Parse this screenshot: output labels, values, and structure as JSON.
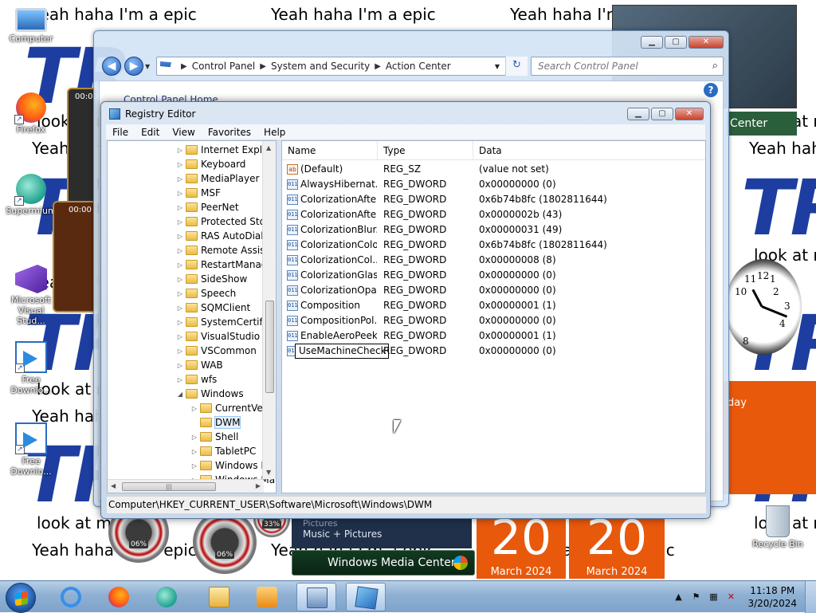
{
  "wallpaper": {
    "repeat_text_1": "Yeah haha I'm a epic",
    "repeat_text_2": "look at m",
    "logo_text": "TR"
  },
  "desktop_icons": [
    {
      "label": "Computer",
      "icon": "computer-icon"
    },
    {
      "label": "Firefox",
      "icon": "firefox-icon"
    },
    {
      "label": "Supermium",
      "icon": "supermium-icon"
    },
    {
      "label": "Microsoft Visual Stud...",
      "icon": "visual-studio-icon"
    },
    {
      "label": "Free Downlo...",
      "icon": "download-icon"
    },
    {
      "label": "Free Downlo...",
      "icon": "download-icon"
    },
    {
      "label": "Recycle Bin",
      "icon": "recycle-bin-icon"
    }
  ],
  "gadgets": {
    "calendar_day": "20",
    "calendar_month": "March 2024",
    "calendar_day_name": "day",
    "media_center_label": "Windows Media Center",
    "media_center_strip": "Music + Pictures",
    "media_center_strip_above": "Pictures",
    "media_center_tab": "Center",
    "cpu_gauge": "06%",
    "mem_gauge": "33%",
    "cpu_gauge_2": "06%",
    "timer_1": "00:00",
    "timer_2": "00:00",
    "clock_numbers": [
      "12",
      "2",
      "3",
      "4",
      "8",
      "10",
      "11",
      "1"
    ]
  },
  "control_panel": {
    "breadcrumb": [
      "Control Panel",
      "System and Security",
      "Action Center"
    ],
    "search_placeholder": "Search Control Panel",
    "home_link": "Control Panel Home",
    "help": "?"
  },
  "registry_editor": {
    "title": "Registry Editor",
    "menu": [
      "File",
      "Edit",
      "View",
      "Favorites",
      "Help"
    ],
    "tree": [
      {
        "label": "Internet Explor",
        "expandable": true,
        "level": 1
      },
      {
        "label": "Keyboard",
        "expandable": true,
        "level": 1
      },
      {
        "label": "MediaPlayer",
        "expandable": true,
        "level": 1
      },
      {
        "label": "MSF",
        "expandable": true,
        "level": 1
      },
      {
        "label": "PeerNet",
        "expandable": true,
        "level": 1
      },
      {
        "label": "Protected Stor",
        "expandable": true,
        "level": 1
      },
      {
        "label": "RAS AutoDial",
        "expandable": true,
        "level": 1
      },
      {
        "label": "Remote Assist",
        "expandable": true,
        "level": 1
      },
      {
        "label": "RestartManag",
        "expandable": true,
        "level": 1
      },
      {
        "label": "SideShow",
        "expandable": true,
        "level": 1
      },
      {
        "label": "Speech",
        "expandable": true,
        "level": 1
      },
      {
        "label": "SQMClient",
        "expandable": true,
        "level": 1
      },
      {
        "label": "SystemCertific",
        "expandable": true,
        "level": 1
      },
      {
        "label": "VisualStudio",
        "expandable": true,
        "level": 1
      },
      {
        "label": "VSCommon",
        "expandable": true,
        "level": 1
      },
      {
        "label": "WAB",
        "expandable": true,
        "level": 1
      },
      {
        "label": "wfs",
        "expandable": true,
        "level": 1
      },
      {
        "label": "Windows",
        "expandable": true,
        "expanded": true,
        "level": 1
      },
      {
        "label": "CurrentVer",
        "expandable": true,
        "level": 2
      },
      {
        "label": "DWM",
        "expandable": false,
        "level": 2,
        "selected": true
      },
      {
        "label": "Shell",
        "expandable": true,
        "level": 2
      },
      {
        "label": "TabletPC",
        "expandable": true,
        "level": 2
      },
      {
        "label": "Windows E",
        "expandable": true,
        "level": 2
      },
      {
        "label": "Windows Mail",
        "expandable": true,
        "level": 2
      }
    ],
    "columns": [
      "Name",
      "Type",
      "Data"
    ],
    "values": [
      {
        "name": "(Default)",
        "type": "REG_SZ",
        "data": "(value not set)",
        "icon": "ab"
      },
      {
        "name": "AlwaysHibernat...",
        "type": "REG_DWORD",
        "data": "0x00000000 (0)",
        "icon": "011"
      },
      {
        "name": "ColorizationAfte...",
        "type": "REG_DWORD",
        "data": "0x6b74b8fc (1802811644)",
        "icon": "011"
      },
      {
        "name": "ColorizationAfte...",
        "type": "REG_DWORD",
        "data": "0x0000002b (43)",
        "icon": "011"
      },
      {
        "name": "ColorizationBlur...",
        "type": "REG_DWORD",
        "data": "0x00000031 (49)",
        "icon": "011"
      },
      {
        "name": "ColorizationColor",
        "type": "REG_DWORD",
        "data": "0x6b74b8fc (1802811644)",
        "icon": "011"
      },
      {
        "name": "ColorizationCol...",
        "type": "REG_DWORD",
        "data": "0x00000008 (8)",
        "icon": "011"
      },
      {
        "name": "ColorizationGlas...",
        "type": "REG_DWORD",
        "data": "0x00000000 (0)",
        "icon": "011"
      },
      {
        "name": "ColorizationOpa...",
        "type": "REG_DWORD",
        "data": "0x00000000 (0)",
        "icon": "011"
      },
      {
        "name": "Composition",
        "type": "REG_DWORD",
        "data": "0x00000001 (1)",
        "icon": "011"
      },
      {
        "name": "CompositionPol...",
        "type": "REG_DWORD",
        "data": "0x00000000 (0)",
        "icon": "011"
      },
      {
        "name": "EnableAeroPeek",
        "type": "REG_DWORD",
        "data": "0x00000001 (1)",
        "icon": "011"
      },
      {
        "name": "UseMachineCheck",
        "type": "REG_DWORD",
        "data": "0x00000000 (0)",
        "icon": "011",
        "renaming": true
      }
    ],
    "status_path": "Computer\\HKEY_CURRENT_USER\\Software\\Microsoft\\Windows\\DWM"
  },
  "taskbar": {
    "time": "11:18 PM",
    "date": "3/20/2024",
    "pinned": [
      "internet-explorer-icon",
      "firefox-icon",
      "supermium-icon",
      "windows-explorer-icon",
      "windows-media-player-icon",
      "gadgets-icon",
      "registry-editor-icon"
    ]
  },
  "colors": {
    "accent": "#1f5fbf",
    "calendar": "#e8590c",
    "wallpaper_logo": "#1d3ea0"
  }
}
